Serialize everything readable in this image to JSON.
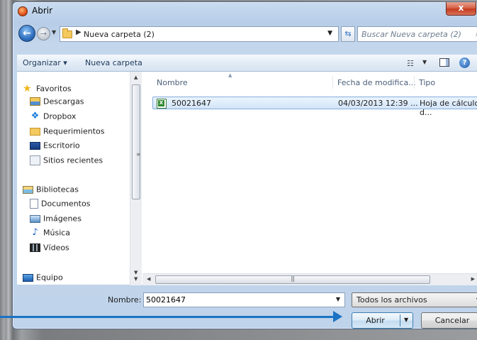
{
  "window": {
    "title": "Abrir",
    "close_label": "x"
  },
  "nav": {
    "breadcrumb": "Nueva carpeta (2)",
    "search_placeholder": "Buscar Nueva carpeta (2)"
  },
  "toolbar": {
    "organize": "Organizar ▾",
    "new_folder": "Nueva carpeta"
  },
  "sidebar": {
    "favorites": "Favoritos",
    "downloads": "Descargas",
    "dropbox": "Dropbox",
    "requirements": "Requerimientos",
    "desktop": "Escritorio",
    "recent": "Sitios recientes",
    "libraries": "Bibliotecas",
    "documents": "Documentos",
    "images": "Imágenes",
    "music": "Música",
    "videos": "Vídeos",
    "computer": "Equipo"
  },
  "columns": {
    "name": "Nombre",
    "date": "Fecha de modifica...",
    "type": "Tipo"
  },
  "files": [
    {
      "name": "50021647",
      "date": "04/03/2013 12:39 ...",
      "type": "Hoja de cálculo d..."
    }
  ],
  "bottom": {
    "name_label": "Nombre:",
    "filename_value": "50021647",
    "filter_value": "Todos los archivos",
    "open_label": "Abrir",
    "cancel_label": "Cancelar"
  },
  "colors": {
    "accent_arrow": "#1a73c4",
    "selection": "#d3e5f9",
    "window_frame": "#c3d6ec"
  }
}
